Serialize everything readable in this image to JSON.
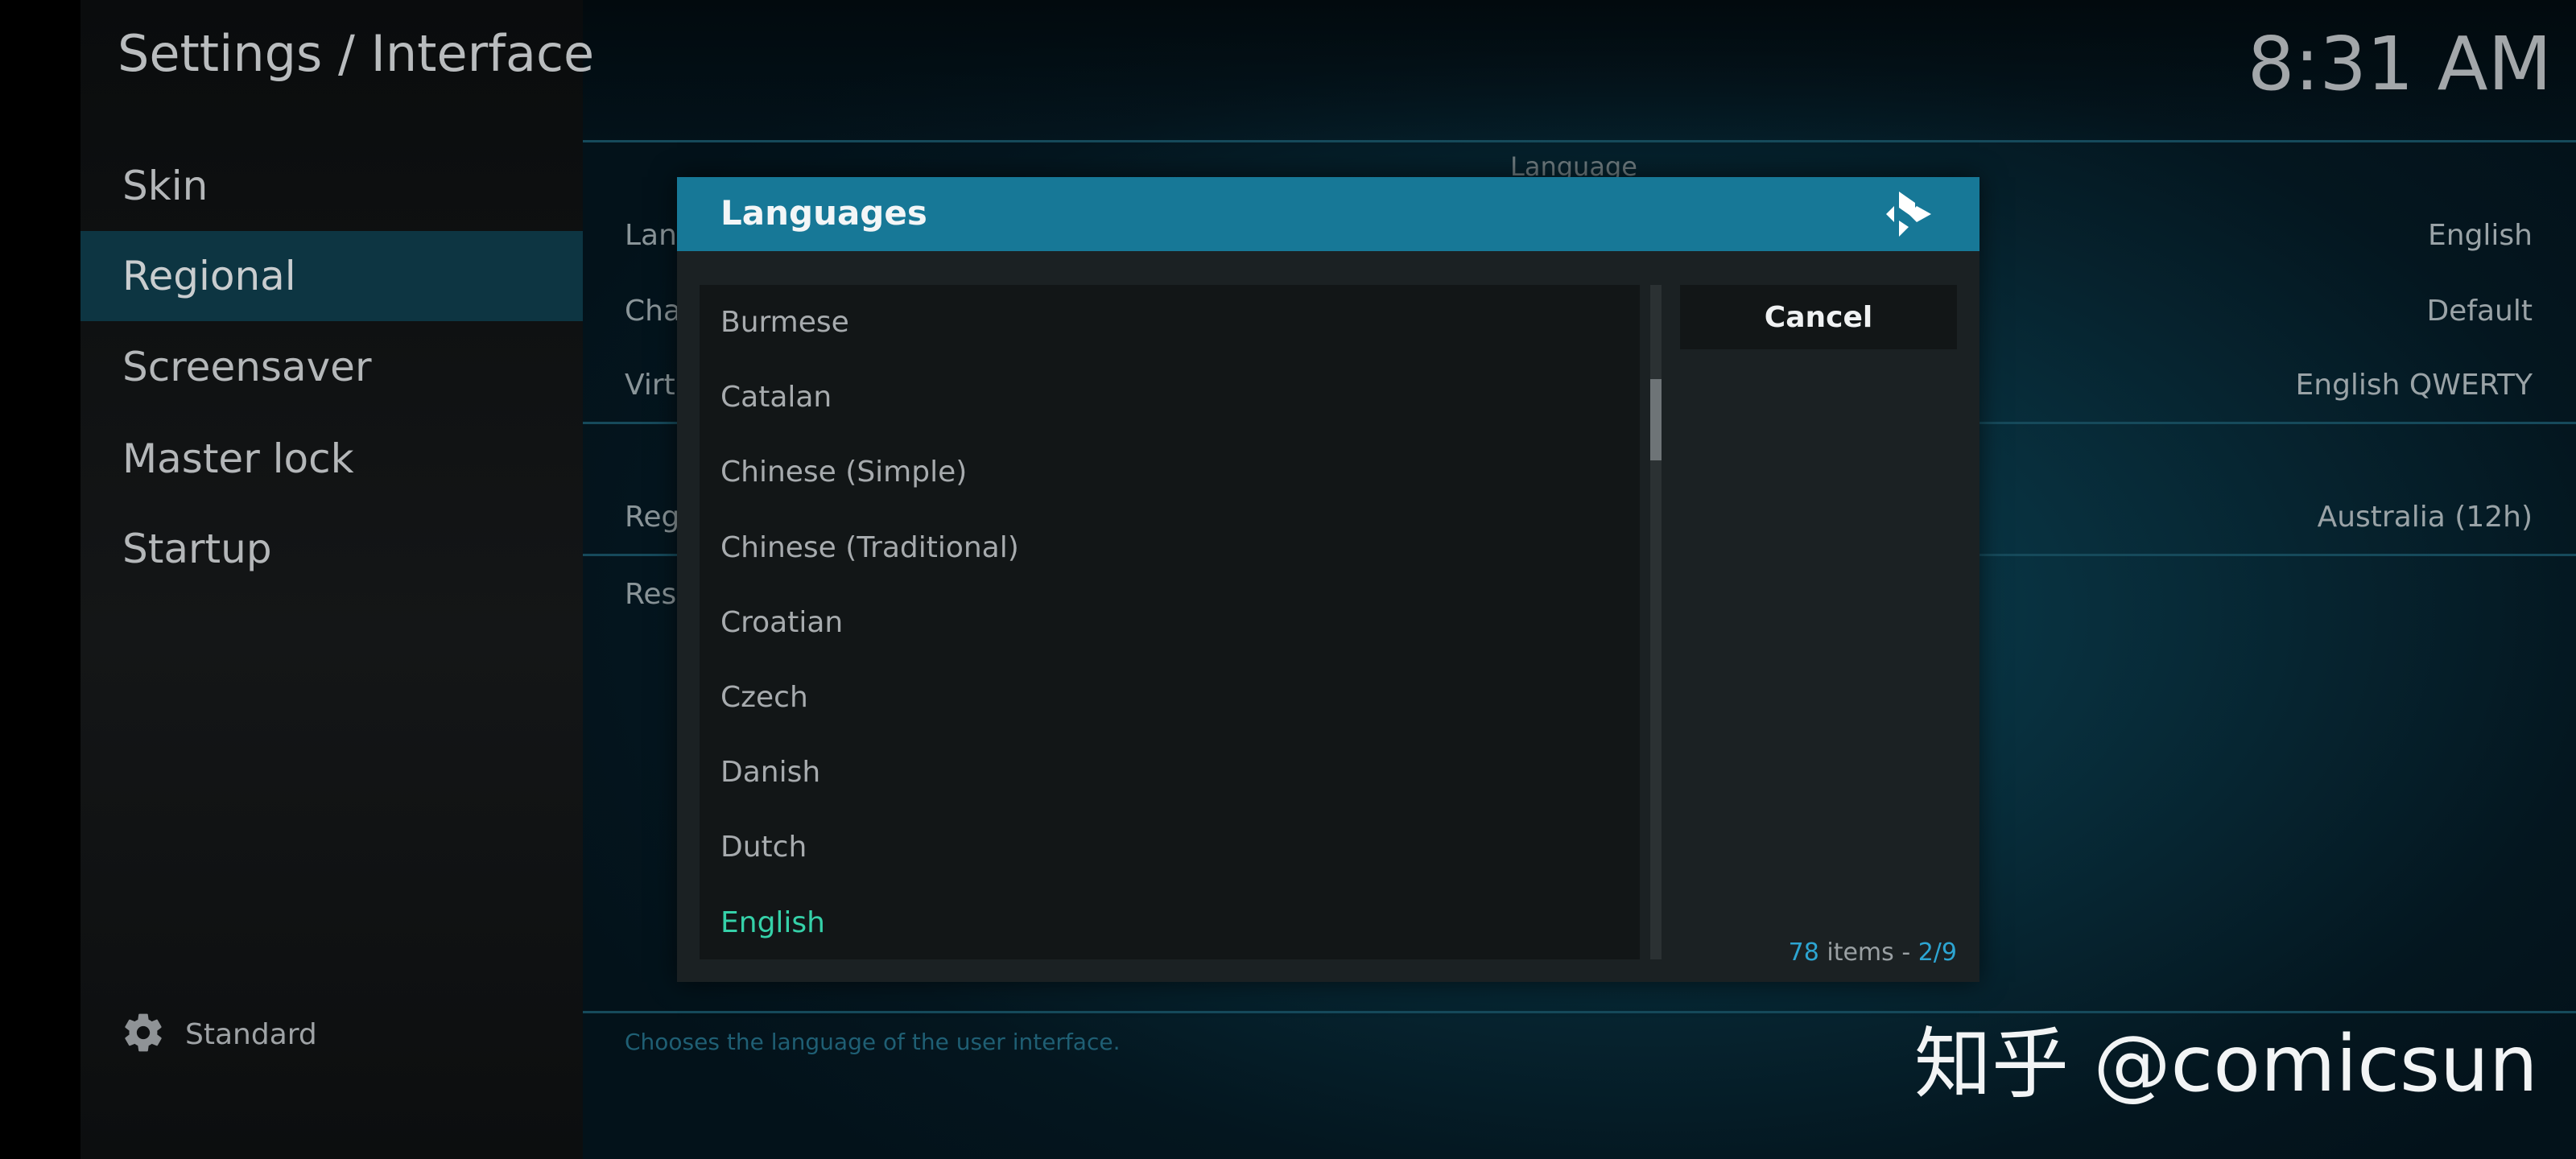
{
  "header": {
    "title": "Settings / Interface",
    "clock": "8:31 AM"
  },
  "sidebar": {
    "items": [
      {
        "label": "Skin",
        "active": false
      },
      {
        "label": "Regional",
        "active": true
      },
      {
        "label": "Screensaver",
        "active": false
      },
      {
        "label": "Master lock",
        "active": false
      },
      {
        "label": "Startup",
        "active": false
      }
    ],
    "footer_label": "Standard"
  },
  "settings": {
    "section_title": "Language",
    "rows": [
      {
        "label_partial": "Lan",
        "value": "English"
      },
      {
        "label_partial": "Cha",
        "value": "Default"
      },
      {
        "label_partial": "Virt",
        "value": "English QWERTY"
      },
      {
        "label_partial": "Reg",
        "value": "Australia (12h)"
      },
      {
        "label_partial": "Res",
        "value": ""
      }
    ],
    "help_text": "Chooses the language of the user interface."
  },
  "dialog": {
    "title": "Languages",
    "items": [
      {
        "label": "Burmese",
        "selected": false
      },
      {
        "label": "Catalan",
        "selected": false
      },
      {
        "label": "Chinese (Simple)",
        "selected": false
      },
      {
        "label": "Chinese (Traditional)",
        "selected": false
      },
      {
        "label": "Croatian",
        "selected": false
      },
      {
        "label": "Czech",
        "selected": false
      },
      {
        "label": "Danish",
        "selected": false
      },
      {
        "label": "Dutch",
        "selected": false
      },
      {
        "label": "English",
        "selected": true
      }
    ],
    "cancel_label": "Cancel",
    "items_total": "78",
    "items_word": "items",
    "items_sep": "-",
    "page": "2/9",
    "scroll_fraction_start": 0.14,
    "scroll_fraction_end": 0.26
  },
  "watermark": "知乎 @comicsun",
  "colors": {
    "accent": "#177897",
    "selected_text": "#35d1a9",
    "count_accent": "#2da5d2"
  },
  "icons": {
    "profile": "gear-icon",
    "logo": "kodi-logo-icon"
  }
}
